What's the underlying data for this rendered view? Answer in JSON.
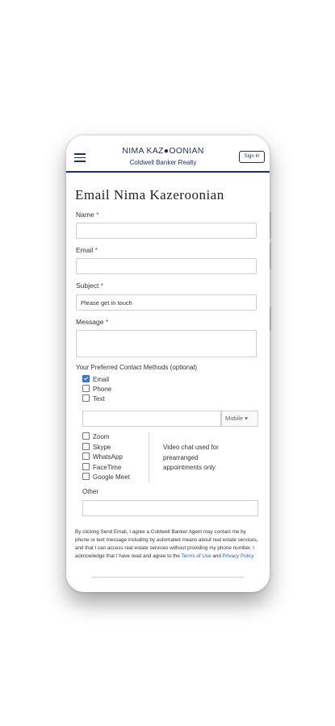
{
  "header": {
    "brand_name": "NIMA KAZ●OONIAN",
    "brand_sub": "Coldwell Banker Realty",
    "signin_label": "Sign In"
  },
  "form": {
    "title": "Email Nima Kazeroonian",
    "name_label": "Name",
    "email_label": "Email",
    "subject_label": "Subject",
    "subject_value": "Please get in touch",
    "message_label": "Message",
    "required_mark": "*"
  },
  "contact_methods": {
    "heading": "Your Preferred Contact Methods (optional)",
    "primary": [
      {
        "label": "Email",
        "checked": true
      },
      {
        "label": "Phone",
        "checked": false
      },
      {
        "label": "Text",
        "checked": false
      }
    ],
    "phone_type": "Mobile ▾",
    "video": [
      {
        "label": "Zoom",
        "checked": false
      },
      {
        "label": "Skype",
        "checked": false
      },
      {
        "label": "WhatsApp",
        "checked": false
      },
      {
        "label": "FaceTime",
        "checked": false
      },
      {
        "label": "Google Meet",
        "checked": false
      }
    ],
    "video_note": "Video chat used for prearranged appointments only",
    "other_label": "Other"
  },
  "disclaimer": {
    "text": "By clicking Send Email, I agree a Coldwell Banker Agent may contact me by phone or text message including by automated means about real estate services, and that I can access real estate services without providing my phone number. I acknowledge that I have read and agree to the ",
    "terms_link": "Terms of Use",
    "and": " and ",
    "privacy_link": "Privacy Policy"
  }
}
